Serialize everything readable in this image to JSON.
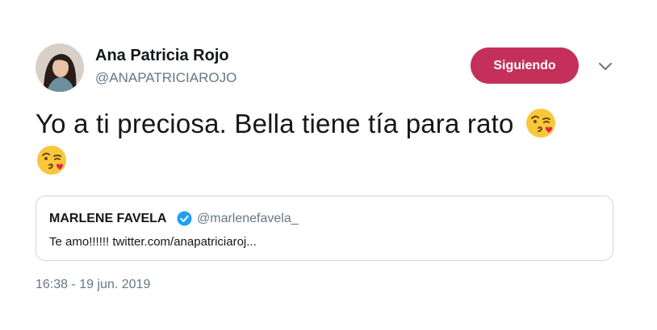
{
  "author": {
    "display_name": "Ana Patricia Rojo",
    "handle": "@ANAPATRICIAROJO",
    "avatar_icon": "profile-photo"
  },
  "follow_button": {
    "label": "Siguiendo",
    "color": "#c4305a"
  },
  "menu_icon": "chevron-down-icon",
  "tweet": {
    "text": "Yo a ti preciosa. Bella tiene tía para rato",
    "emojis": [
      "face-blowing-kiss-icon",
      "face-blowing-kiss-icon"
    ]
  },
  "quoted_tweet": {
    "display_name": "MARLENE FAVELA",
    "verified": true,
    "handle": "@marlenefavela_",
    "text": "Te amo!!!!!! twitter.com/anapatriciaroj..."
  },
  "timestamp": "16:38 - 19 jun. 2019",
  "colors": {
    "primary_text": "#14171a",
    "secondary_text": "#657786",
    "border": "#ccd6dd",
    "verified_blue": "#1da1f2"
  }
}
